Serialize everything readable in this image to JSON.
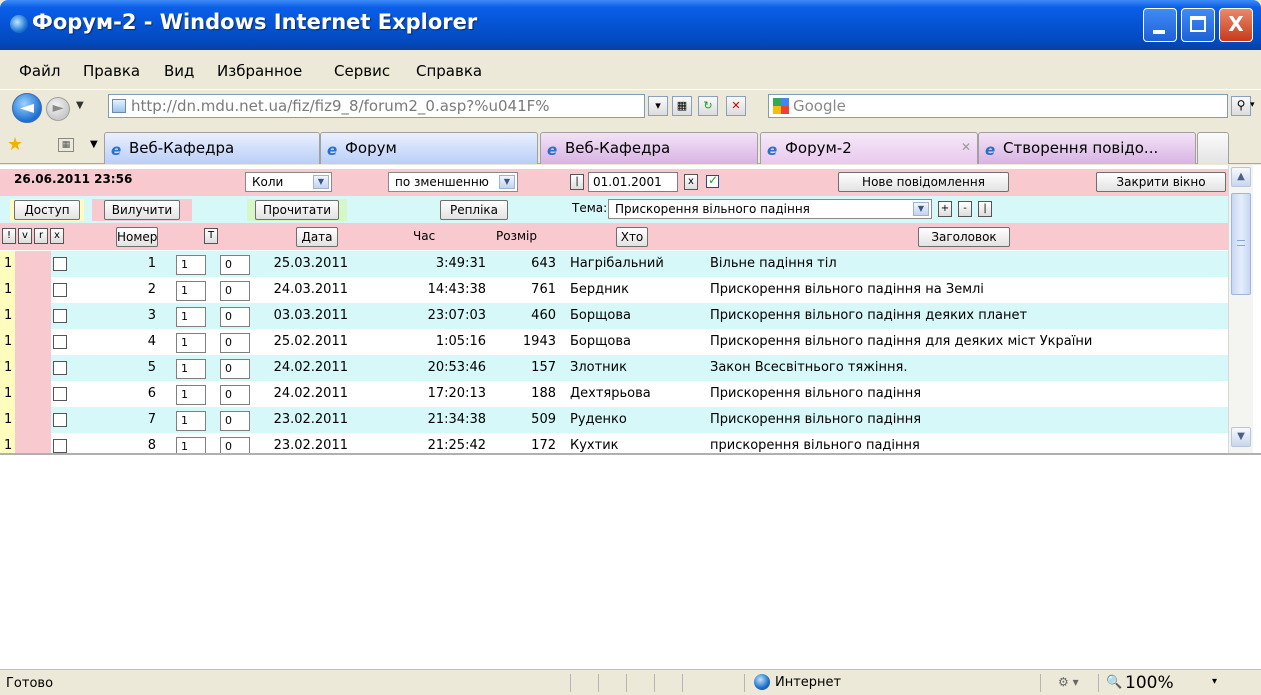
{
  "window": {
    "title": "Форум-2 - Windows Internet Explorer",
    "minimize": "_",
    "close": "X"
  },
  "menu": [
    "Файл",
    "Правка",
    "Вид",
    "Избранное",
    "Сервис",
    "Справка"
  ],
  "address": {
    "url": "http://dn.mdu.net.ua/fiz/fiz9_8/forum2_0.asp?%u041F%",
    "search_placeholder": "Google"
  },
  "tabs": [
    {
      "label": "Веб-Кафедра"
    },
    {
      "label": "Форум"
    },
    {
      "label": "Веб-Кафедра"
    },
    {
      "label": "Форум-2"
    },
    {
      "label": "Створення повідо..."
    }
  ],
  "forum": {
    "datetime": "26.06.2011 23:56",
    "when_select": "Коли",
    "order_select": "по зменшенню",
    "date_filter": "01.01.2001",
    "new_message": "Нове повідомлення",
    "close_window": "Закрити вікно",
    "access": "Доступ",
    "delete": "Вилучити",
    "read": "Прочитати",
    "reply": "Репліка",
    "topic_label": "Тема:",
    "topic_value": "Прискорення вільного падіння",
    "col_headers": {
      "flags": [
        "!",
        "v",
        "r",
        "x"
      ],
      "number": "Номер",
      "t": "T",
      "date": "Дата",
      "time": "Час",
      "size": "Розмір",
      "who": "Хто",
      "title": "Заголовок"
    },
    "rows": [
      {
        "flag": "1",
        "num": "1",
        "a": "1",
        "b": "0",
        "date": "25.03.2011",
        "time": "3:49:31",
        "size": "643",
        "who": "Нагрібальний",
        "title": "Вільне падіння тіл"
      },
      {
        "flag": "1",
        "num": "2",
        "a": "1",
        "b": "0",
        "date": "24.03.2011",
        "time": "14:43:38",
        "size": "761",
        "who": "Бердник",
        "title": "Прискорення вільного падіння на Землі"
      },
      {
        "flag": "1",
        "num": "3",
        "a": "1",
        "b": "0",
        "date": "03.03.2011",
        "time": "23:07:03",
        "size": "460",
        "who": "Борщова",
        "title": "Прискорення вільного падіння деяких планет"
      },
      {
        "flag": "1",
        "num": "4",
        "a": "1",
        "b": "0",
        "date": "25.02.2011",
        "time": "1:05:16",
        "size": "1943",
        "who": "Борщова",
        "title": "Прискорення вільного падіння для деяких міст України"
      },
      {
        "flag": "1",
        "num": "5",
        "a": "1",
        "b": "0",
        "date": "24.02.2011",
        "time": "20:53:46",
        "size": "157",
        "who": "Злотник",
        "title": "Закон Всесвітнього тяжіння."
      },
      {
        "flag": "1",
        "num": "6",
        "a": "1",
        "b": "0",
        "date": "24.02.2011",
        "time": "17:20:13",
        "size": "188",
        "who": "Дехтярьова",
        "title": "Прискорення вільного падіння"
      },
      {
        "flag": "1",
        "num": "7",
        "a": "1",
        "b": "0",
        "date": "23.02.2011",
        "time": "21:34:38",
        "size": "509",
        "who": "Руденко",
        "title": "Прискорення вільного падіння"
      },
      {
        "flag": "1",
        "num": "8",
        "a": "1",
        "b": "0",
        "date": "23.02.2011",
        "time": "21:25:42",
        "size": "172",
        "who": "Кухтик",
        "title": "прискорення вільного падіння"
      }
    ]
  },
  "status": {
    "text": "Готово",
    "zone": "Интернет",
    "zoom": "100%"
  }
}
